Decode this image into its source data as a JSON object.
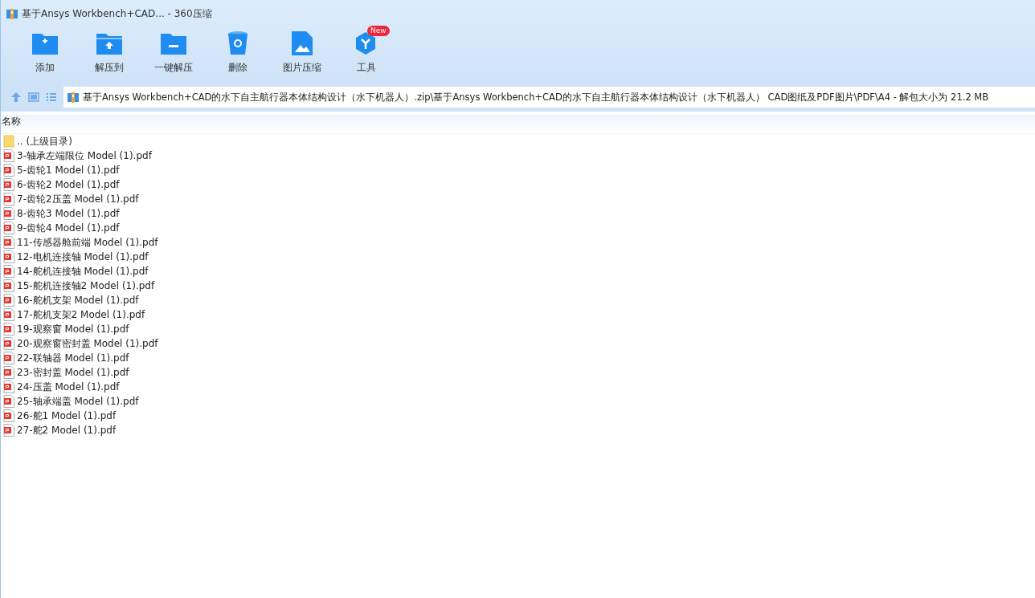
{
  "window": {
    "title": "基于Ansys Workbench+CAD... - 360压缩"
  },
  "toolbar": [
    {
      "label": "添加",
      "kind": "add"
    },
    {
      "label": "解压到",
      "kind": "extract-to"
    },
    {
      "label": "一键解压",
      "kind": "extract"
    },
    {
      "label": "删除",
      "kind": "delete"
    },
    {
      "label": "图片压缩",
      "kind": "image"
    },
    {
      "label": "工具",
      "kind": "tools",
      "badge": "New"
    }
  ],
  "address_bar": {
    "path": "基于Ansys Workbench+CAD的水下自主航行器本体结构设计（水下机器人）.zip\\基于Ansys Workbench+CAD的水下自主航行器本体结构设计（水下机器人） CAD图纸及PDF图片\\PDF\\A4 - 解包大小为 21.2 MB"
  },
  "file_list": {
    "columns": [
      "名称"
    ],
    "rows": [
      {
        "name": ".. (上级目录)",
        "kind": "folder"
      },
      {
        "name": "3-轴承左端限位 Model (1).pdf",
        "kind": "pdf"
      },
      {
        "name": "5-齿轮1 Model (1).pdf",
        "kind": "pdf"
      },
      {
        "name": "6-齿轮2 Model (1).pdf",
        "kind": "pdf"
      },
      {
        "name": "7-齿轮2压盖 Model (1).pdf",
        "kind": "pdf"
      },
      {
        "name": "8-齿轮3 Model (1).pdf",
        "kind": "pdf"
      },
      {
        "name": "9-齿轮4 Model (1).pdf",
        "kind": "pdf"
      },
      {
        "name": "11-传感器舱前端 Model (1).pdf",
        "kind": "pdf"
      },
      {
        "name": "12-电机连接轴 Model (1).pdf",
        "kind": "pdf"
      },
      {
        "name": "14-舵机连接轴 Model (1).pdf",
        "kind": "pdf"
      },
      {
        "name": "15-舵机连接轴2 Model (1).pdf",
        "kind": "pdf"
      },
      {
        "name": "16-舵机支架 Model (1).pdf",
        "kind": "pdf"
      },
      {
        "name": "17-舵机支架2 Model (1).pdf",
        "kind": "pdf"
      },
      {
        "name": "19-观察窗 Model (1).pdf",
        "kind": "pdf"
      },
      {
        "name": "20-观察窗密封盖 Model (1).pdf",
        "kind": "pdf"
      },
      {
        "name": "22-联轴器 Model (1).pdf",
        "kind": "pdf"
      },
      {
        "name": "23-密封盖 Model (1).pdf",
        "kind": "pdf"
      },
      {
        "name": "24-压盖 Model (1).pdf",
        "kind": "pdf"
      },
      {
        "name": "25-轴承端盖 Model (1).pdf",
        "kind": "pdf"
      },
      {
        "name": "26-舵1 Model (1).pdf",
        "kind": "pdf"
      },
      {
        "name": "27-舵2 Model (1).pdf",
        "kind": "pdf"
      }
    ]
  }
}
